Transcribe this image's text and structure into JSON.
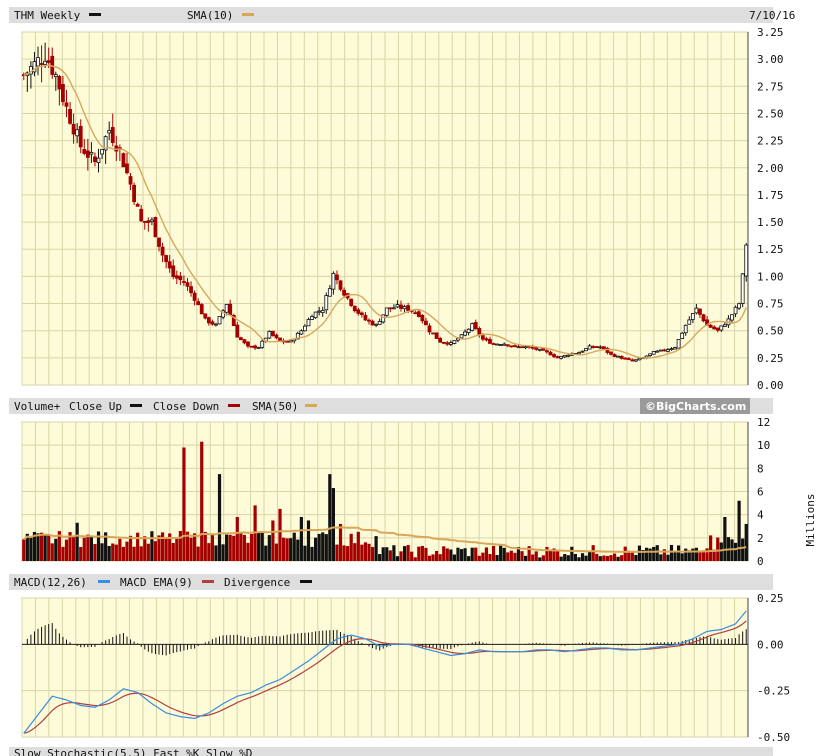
{
  "header": {
    "ticker": "THM Weekly",
    "sma_label": "SMA(10)",
    "date": "7/10/16"
  },
  "volume_header": {
    "label_prefix": "Volume+",
    "close_up": "Close Up",
    "close_down": "Close Down",
    "sma_label": "SMA(50)",
    "watermark": "©BigCharts.com"
  },
  "macd_header": {
    "macd_label": "MACD(12,26)",
    "ema_label": "MACD EMA(9)",
    "divergence_label": "Divergence"
  },
  "stoch_header": {
    "text": "Slow Stochastic(5,5)  Fast %K  Slow %D"
  },
  "colors": {
    "panel_bg": "#fdfbd8",
    "grid": "#d8d6a8",
    "up": "#111111",
    "down": "#a50000",
    "sma": "#d9a75a",
    "macd": "#3a8de0",
    "ema": "#b04040",
    "header_bg": "#dedede"
  },
  "chart_data": [
    {
      "type": "candlestick",
      "title": "THM Weekly",
      "ylim": [
        0,
        3.25
      ],
      "yticks": [
        "3.25",
        "3.00",
        "2.75",
        "2.50",
        "2.25",
        "2.00",
        "1.75",
        "1.50",
        "1.25",
        "1.00",
        "0.75",
        "0.50",
        "0.25",
        "0.00"
      ],
      "close_anchors": [
        [
          0,
          2.85
        ],
        [
          3,
          2.95
        ],
        [
          6,
          3.05
        ],
        [
          9,
          2.85
        ],
        [
          12,
          2.55
        ],
        [
          16,
          2.2
        ],
        [
          20,
          2.05
        ],
        [
          24,
          2.35
        ],
        [
          27,
          2.15
        ],
        [
          30,
          1.85
        ],
        [
          33,
          1.5
        ],
        [
          36,
          1.5
        ],
        [
          39,
          1.2
        ],
        [
          42,
          1.0
        ],
        [
          45,
          0.95
        ],
        [
          48,
          0.8
        ],
        [
          51,
          0.6
        ],
        [
          54,
          0.55
        ],
        [
          57,
          0.75
        ],
        [
          60,
          0.45
        ],
        [
          63,
          0.35
        ],
        [
          66,
          0.35
        ],
        [
          69,
          0.48
        ],
        [
          72,
          0.4
        ],
        [
          75,
          0.4
        ],
        [
          78,
          0.5
        ],
        [
          81,
          0.65
        ],
        [
          84,
          0.7
        ],
        [
          87,
          1.02
        ],
        [
          90,
          0.85
        ],
        [
          93,
          0.7
        ],
        [
          96,
          0.6
        ],
        [
          99,
          0.55
        ],
        [
          102,
          0.7
        ],
        [
          105,
          0.72
        ],
        [
          108,
          0.7
        ],
        [
          111,
          0.65
        ],
        [
          114,
          0.5
        ],
        [
          117,
          0.4
        ],
        [
          120,
          0.38
        ],
        [
          123,
          0.45
        ],
        [
          126,
          0.55
        ],
        [
          129,
          0.42
        ],
        [
          132,
          0.38
        ],
        [
          135,
          0.38
        ],
        [
          138,
          0.35
        ],
        [
          141,
          0.35
        ],
        [
          144,
          0.33
        ],
        [
          147,
          0.3
        ],
        [
          150,
          0.25
        ],
        [
          153,
          0.28
        ],
        [
          156,
          0.3
        ],
        [
          159,
          0.35
        ],
        [
          162,
          0.35
        ],
        [
          165,
          0.28
        ],
        [
          168,
          0.25
        ],
        [
          171,
          0.22
        ],
        [
          174,
          0.25
        ],
        [
          177,
          0.3
        ],
        [
          180,
          0.32
        ],
        [
          183,
          0.35
        ],
        [
          186,
          0.55
        ],
        [
          189,
          0.7
        ],
        [
          192,
          0.55
        ],
        [
          195,
          0.5
        ],
        [
          198,
          0.6
        ],
        [
          201,
          0.75
        ],
        [
          202,
          1.0
        ],
        [
          203,
          1.3
        ]
      ],
      "volume": {
        "ylabel": "Millions",
        "ylim": [
          0,
          12
        ],
        "yticks": [
          "12",
          "10",
          "8",
          "6",
          "4",
          "2",
          "0"
        ],
        "spikes": [
          [
            15,
            3.3
          ],
          [
            45,
            9.8
          ],
          [
            50,
            10.3
          ],
          [
            55,
            7.5
          ],
          [
            60,
            3.8
          ],
          [
            65,
            4.8
          ],
          [
            70,
            3.5
          ],
          [
            72,
            4.5
          ],
          [
            78,
            3.8
          ],
          [
            80,
            3.5
          ],
          [
            86,
            7.5
          ],
          [
            87,
            6.3
          ],
          [
            89,
            3.2
          ],
          [
            197,
            3.8
          ],
          [
            201,
            5.2
          ],
          [
            203,
            3.2
          ]
        ]
      },
      "macd": {
        "ylim": [
          -0.5,
          0.25
        ],
        "yticks": [
          "0.25",
          "0.00",
          "-0.25",
          "-0.50"
        ],
        "anchors": [
          [
            0,
            -0.48
          ],
          [
            4,
            -0.38
          ],
          [
            8,
            -0.28
          ],
          [
            12,
            -0.3
          ],
          [
            16,
            -0.33
          ],
          [
            20,
            -0.34
          ],
          [
            24,
            -0.3
          ],
          [
            28,
            -0.24
          ],
          [
            32,
            -0.26
          ],
          [
            36,
            -0.32
          ],
          [
            40,
            -0.37
          ],
          [
            44,
            -0.39
          ],
          [
            48,
            -0.4
          ],
          [
            52,
            -0.37
          ],
          [
            56,
            -0.32
          ],
          [
            60,
            -0.28
          ],
          [
            64,
            -0.26
          ],
          [
            68,
            -0.22
          ],
          [
            72,
            -0.19
          ],
          [
            76,
            -0.14
          ],
          [
            80,
            -0.09
          ],
          [
            84,
            -0.03
          ],
          [
            88,
            0.03
          ],
          [
            92,
            0.05
          ],
          [
            96,
            0.03
          ],
          [
            100,
            -0.01
          ],
          [
            104,
            -0.0
          ],
          [
            108,
            0.0
          ],
          [
            112,
            -0.02
          ],
          [
            116,
            -0.04
          ],
          [
            120,
            -0.06
          ],
          [
            124,
            -0.05
          ],
          [
            128,
            -0.03
          ],
          [
            132,
            -0.04
          ],
          [
            136,
            -0.04
          ],
          [
            140,
            -0.04
          ],
          [
            144,
            -0.03
          ],
          [
            148,
            -0.03
          ],
          [
            152,
            -0.04
          ],
          [
            156,
            -0.03
          ],
          [
            160,
            -0.02
          ],
          [
            164,
            -0.02
          ],
          [
            168,
            -0.03
          ],
          [
            172,
            -0.03
          ],
          [
            176,
            -0.02
          ],
          [
            180,
            -0.01
          ],
          [
            184,
            0.0
          ],
          [
            188,
            0.03
          ],
          [
            192,
            0.07
          ],
          [
            196,
            0.08
          ],
          [
            200,
            0.11
          ],
          [
            203,
            0.18
          ]
        ]
      }
    }
  ]
}
